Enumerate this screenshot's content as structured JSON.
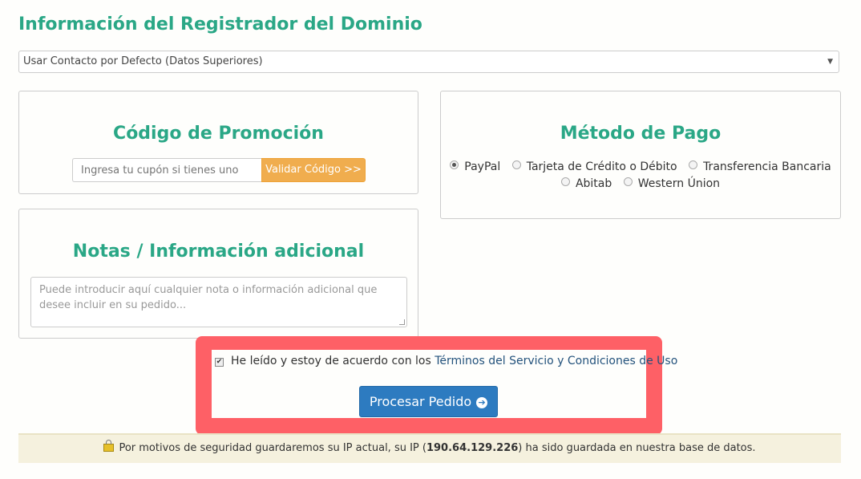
{
  "registrar": {
    "title": "Información del Registrador del Dominio",
    "select_value": "Usar Contacto por Defecto (Datos Superiores)"
  },
  "promo": {
    "title": "Código de Promoción",
    "input_placeholder": "Ingresa tu cupón si tienes uno",
    "validate_label": "Validar Código >>"
  },
  "payment": {
    "title": "Método de Pago",
    "options": [
      {
        "label": "PayPal",
        "selected": true
      },
      {
        "label": "Tarjeta de Crédito o Débito",
        "selected": false
      },
      {
        "label": "Transferencia Bancaria",
        "selected": false
      },
      {
        "label": "Abitab",
        "selected": false
      },
      {
        "label": "Western Únion",
        "selected": false
      }
    ]
  },
  "notes": {
    "title": "Notas / Información adicional",
    "placeholder": "Puede introducir aquí cualquier nota o información adicional que desee incluir en su pedido..."
  },
  "terms": {
    "checked": true,
    "text": "He leído y estoy de acuerdo con los",
    "link": "Términos del Servicio y Condiciones de Uso"
  },
  "process": {
    "label": "Procesar Pedido"
  },
  "security": {
    "text_before": "Por motivos de seguridad guardaremos su IP actual, su IP (",
    "ip": "190.64.129.226",
    "text_after": ") ha sido guardada en nuestra base de datos."
  },
  "colors": {
    "accent": "#2aa786",
    "highlight": "#fe6066",
    "primary_button": "#2d7bc0",
    "warning_button": "#f0ad4e"
  }
}
